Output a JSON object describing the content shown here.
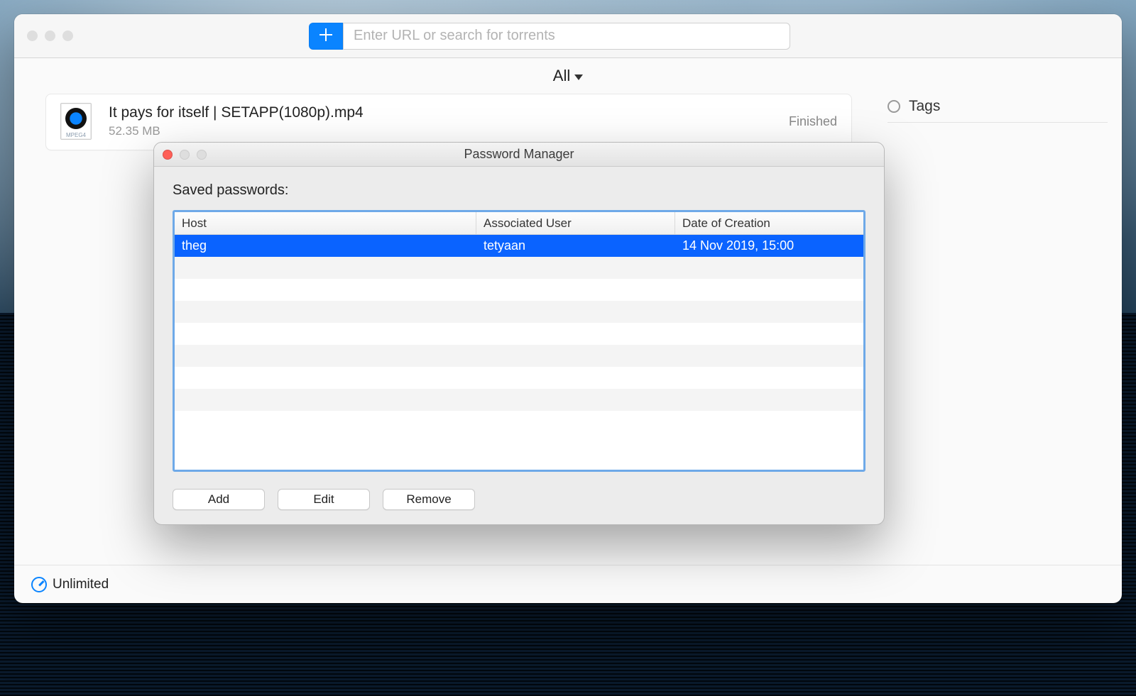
{
  "main": {
    "search_placeholder": "Enter URL or search for torrents",
    "filter_label": "All",
    "tags_title": "Tags",
    "footer_speed": "Unlimited",
    "torrent": {
      "title": "It pays for itself | SETAPP(1080p).mp4",
      "size": "52.35 MB",
      "status": "Finished"
    }
  },
  "dialog": {
    "title": "Password Manager",
    "subtitle": "Saved passwords:",
    "columns": {
      "host": "Host",
      "user": "Associated User",
      "date": "Date of Creation"
    },
    "rows": [
      {
        "host": "theg",
        "user": "tetyaan",
        "date": "14 Nov 2019, 15:00",
        "selected": true
      }
    ],
    "buttons": {
      "add": "Add",
      "edit": "Edit",
      "remove": "Remove"
    }
  }
}
